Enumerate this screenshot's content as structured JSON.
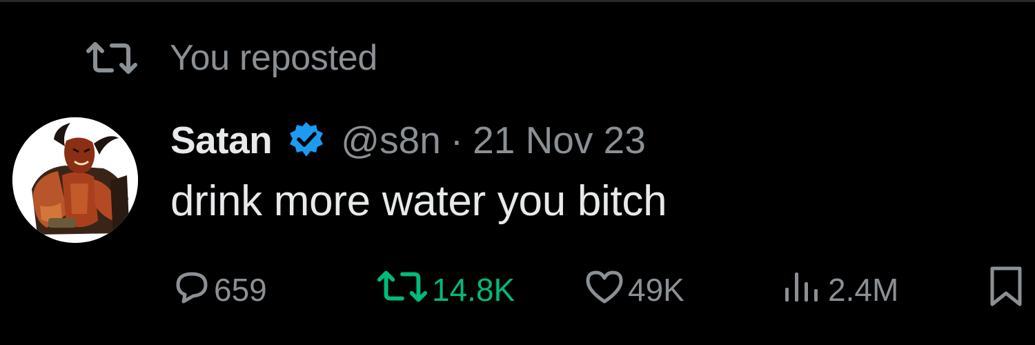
{
  "repost_banner": {
    "label": "You reposted",
    "icon": "repost-icon"
  },
  "post": {
    "author": {
      "display_name": "Satan",
      "handle": "@s8n",
      "verified": true,
      "avatar": "avatar-image"
    },
    "separator": "·",
    "date": "21 Nov 23",
    "text": "drink more water you bitch"
  },
  "actions": {
    "replies": "659",
    "reposts": "14.8K",
    "likes": "49K",
    "views": "2.4M"
  },
  "colors": {
    "background": "#000000",
    "primary_text": "#e7e9ea",
    "secondary_text": "#8b9095",
    "reposted_green": "#00ba7c",
    "verified_blue": "#1d9bf0"
  }
}
